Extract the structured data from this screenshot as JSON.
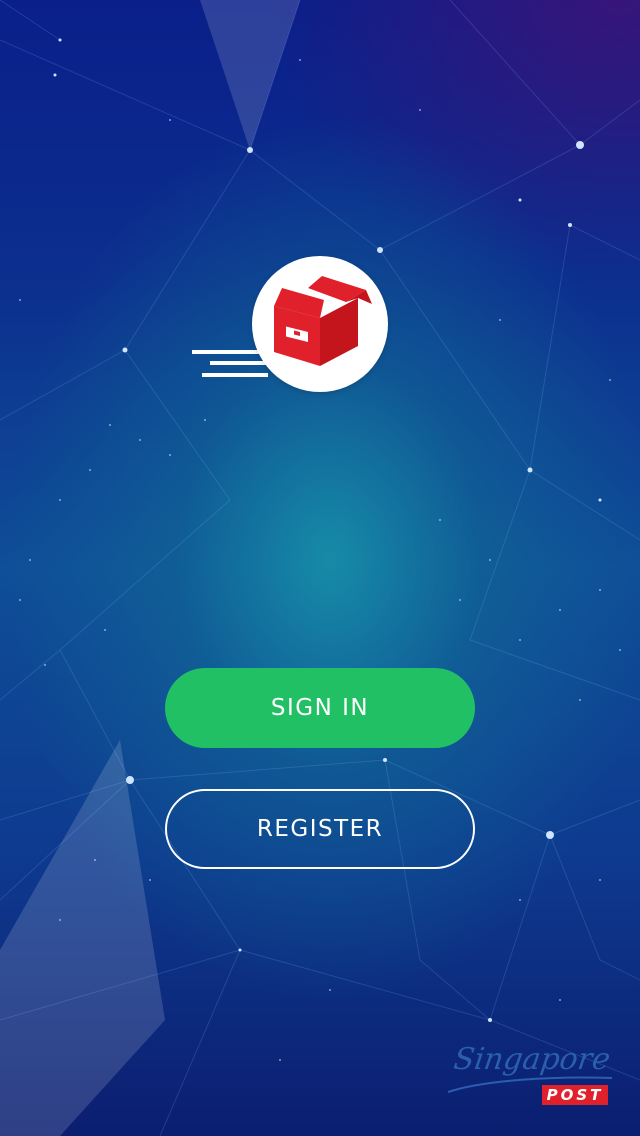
{
  "app": {
    "logo_icon": "delivery-box-icon",
    "accent_color": "#22c064",
    "logo_color": "#e0202a"
  },
  "actions": {
    "sign_in_label": "SIGN IN",
    "register_label": "REGISTER"
  },
  "branding": {
    "script_text": "Singapore",
    "post_text": "POST"
  }
}
